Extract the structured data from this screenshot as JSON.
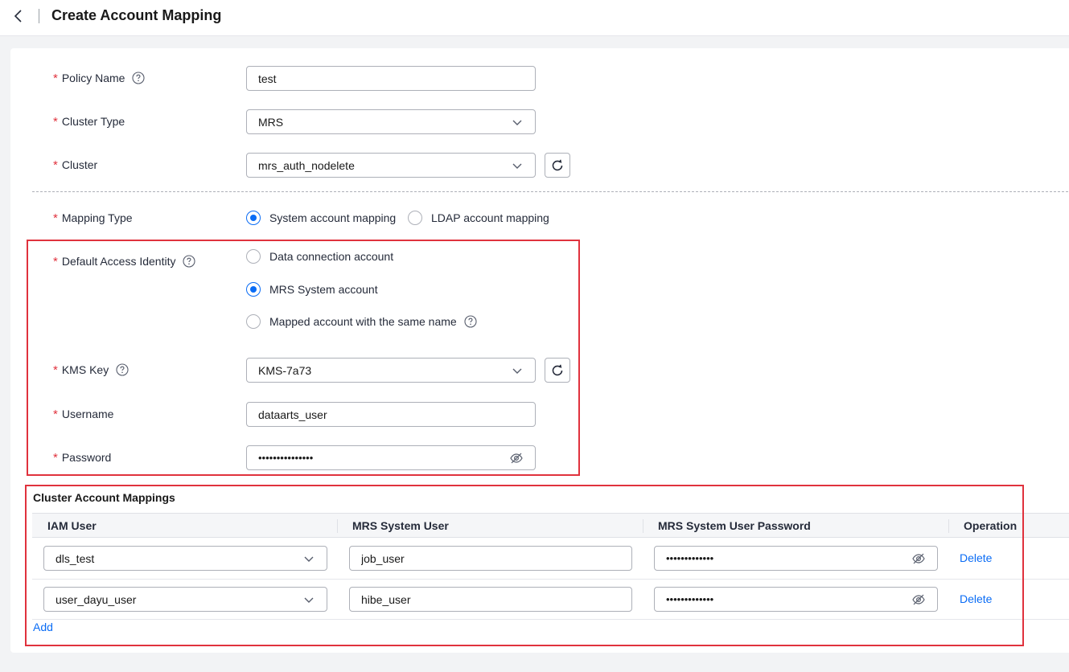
{
  "header": {
    "title": "Create Account Mapping"
  },
  "form": {
    "policy_name": {
      "label": "Policy Name",
      "value": "test"
    },
    "cluster_type": {
      "label": "Cluster Type",
      "value": "MRS"
    },
    "cluster": {
      "label": "Cluster",
      "value": "mrs_auth_nodelete"
    },
    "mapping_type": {
      "label": "Mapping Type",
      "options": [
        "System account mapping",
        "LDAP account mapping"
      ],
      "selected": "System account mapping"
    },
    "default_access_identity": {
      "label": "Default Access Identity",
      "options": [
        "Data connection account",
        "MRS System account",
        "Mapped account with the same name"
      ],
      "selected": "MRS System account"
    },
    "kms_key": {
      "label": "KMS Key",
      "value": "KMS-7a73"
    },
    "username": {
      "label": "Username",
      "value": "dataarts_user"
    },
    "password": {
      "label": "Password",
      "value": "•••••••••••••••"
    }
  },
  "mappings": {
    "title": "Cluster Account Mappings",
    "columns": [
      "IAM User",
      "MRS System User",
      "MRS System User Password",
      "Operation"
    ],
    "rows": [
      {
        "iam_user": "dls_test",
        "mrs_user": "job_user",
        "password": "•••••••••••••",
        "action": "Delete"
      },
      {
        "iam_user": "user_dayu_user",
        "mrs_user": "hibe_user",
        "password": "•••••••••••••",
        "action": "Delete"
      }
    ],
    "add_label": "Add"
  },
  "colors": {
    "accent": "#0a6cf5",
    "required": "#e0323d",
    "highlight_box": "#e0323d"
  }
}
